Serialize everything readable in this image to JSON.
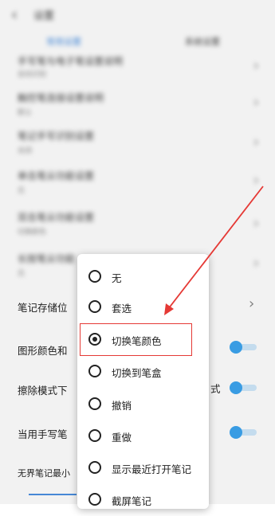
{
  "background": {
    "title": "设置",
    "tabs": [
      "常用设置",
      "系统设置"
    ],
    "blurred_rows": [
      {
        "title": "手写笔与电子笔设置说明",
        "subtitle": "自动识别"
      },
      {
        "title": "触控笔连接设置说明",
        "subtitle": "默认"
      },
      {
        "title": "笔记手写识别设置",
        "subtitle": "关闭"
      },
      {
        "title": "单击笔尖功能设置",
        "subtitle": "无"
      },
      {
        "title": "双击笔尖功能设置",
        "subtitle": "切换颜色"
      },
      {
        "title": "长按笔尖功能",
        "subtitle": "无"
      }
    ],
    "rows": [
      {
        "label": "笔记存储位"
      },
      {
        "label": "图形颜色和"
      },
      {
        "label": "擦除模式下"
      },
      {
        "label": "当用手写笔"
      },
      {
        "label": "无界笔记最小"
      }
    ],
    "side_text": "式"
  },
  "menu": {
    "items": [
      {
        "label": "无"
      },
      {
        "label": "套选"
      },
      {
        "label": "切换笔颜色"
      },
      {
        "label": "切换到笔盒"
      },
      {
        "label": "撤销"
      },
      {
        "label": "重做"
      },
      {
        "label": "显示最近打开笔记"
      },
      {
        "label": "截屏笔记"
      }
    ],
    "selected_index": 2
  },
  "colors": {
    "accent": "#3da5f0",
    "annotation": "#e53935"
  }
}
